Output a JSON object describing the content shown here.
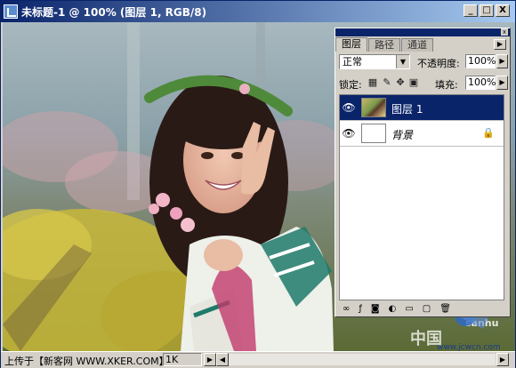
{
  "window": {
    "title": "未标题-1 @ 100% (图层 1, RGB/8)",
    "buttons": {
      "minimize": "_",
      "maximize": "□",
      "close": "X"
    }
  },
  "canvas": {
    "watermark_text": "中国",
    "logo_text": "sanhu",
    "site_text": "www.jcwcn.com"
  },
  "statusbar": {
    "text": "上传于【新客网 WWW.XKER.COM】",
    "size_text": "1K"
  },
  "layers_panel": {
    "tabs": [
      {
        "label": "图层",
        "active": true
      },
      {
        "label": "路径",
        "active": false
      },
      {
        "label": "通道",
        "active": false
      }
    ],
    "blend_mode": "正常",
    "opacity_label": "不透明度:",
    "opacity_value": "100%",
    "lock_label": "锁定:",
    "fill_label": "填充:",
    "fill_value": "100%",
    "layers": [
      {
        "name": "图层 1",
        "selected": true,
        "locked": false
      },
      {
        "name": "背景",
        "selected": false,
        "locked": true
      }
    ]
  }
}
